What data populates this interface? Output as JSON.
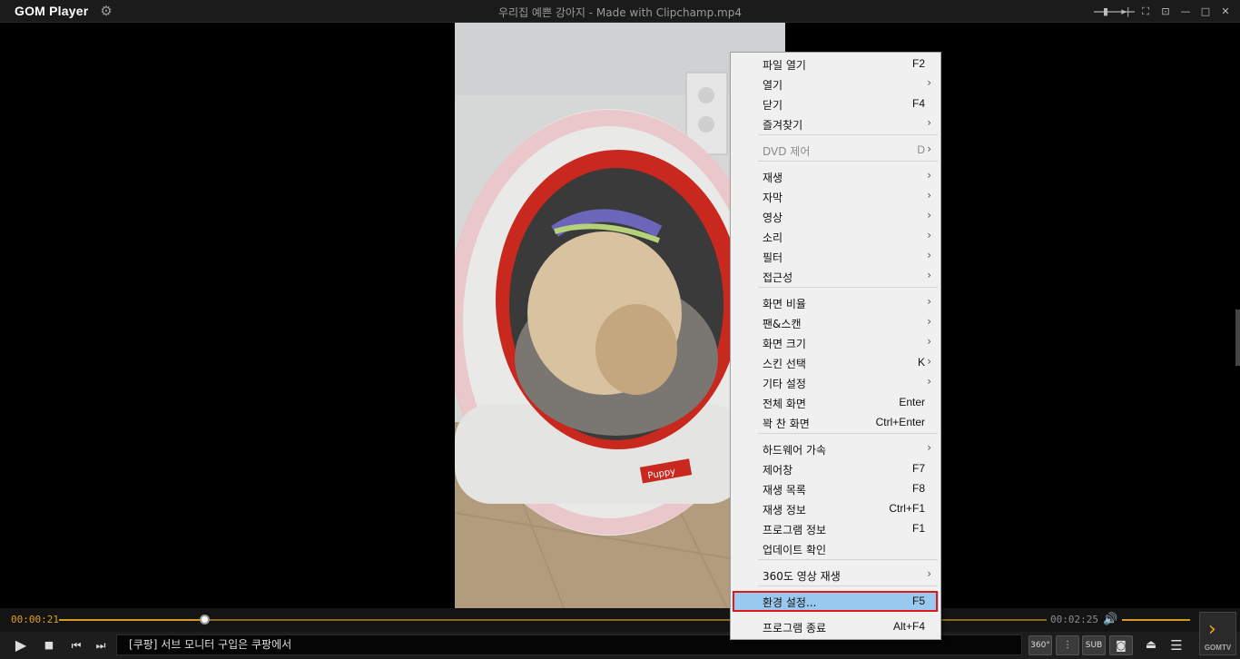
{
  "app": {
    "logo": "GOM Player",
    "window_title": "우리집 예쁜 강아지 - Made with Clipchamp.mp4"
  },
  "player": {
    "time_current": "00:00:21",
    "time_total": "00:02:25",
    "progress_fraction": 0.15,
    "volume_fraction": 1.0,
    "ticker_text": "[쿠팡] 서브 모니터 구입은 쿠팡에서",
    "buttons": {
      "sub": "SUB",
      "360": "360°",
      "gomtv": "GOMTV"
    }
  },
  "context_menu": {
    "highlighted": "환경 설정...",
    "items": [
      {
        "label": "파일 열기",
        "shortcut": "F2",
        "submenu": false
      },
      {
        "label": "열기",
        "shortcut": "",
        "submenu": true
      },
      {
        "label": "닫기",
        "shortcut": "F4",
        "submenu": false
      },
      {
        "label": "즐겨찾기",
        "shortcut": "",
        "submenu": true
      },
      {
        "label": "DVD 제어",
        "shortcut": "D",
        "submenu": true,
        "disabled": true
      },
      {
        "label": "재생",
        "shortcut": "",
        "submenu": true
      },
      {
        "label": "자막",
        "shortcut": "",
        "submenu": true
      },
      {
        "label": "영상",
        "shortcut": "",
        "submenu": true
      },
      {
        "label": "소리",
        "shortcut": "",
        "submenu": true
      },
      {
        "label": "필터",
        "shortcut": "",
        "submenu": true
      },
      {
        "label": "접근성",
        "shortcut": "",
        "submenu": true
      },
      {
        "label": "화면 비율",
        "shortcut": "",
        "submenu": true
      },
      {
        "label": "팬&스캔",
        "shortcut": "",
        "submenu": true
      },
      {
        "label": "화면 크기",
        "shortcut": "",
        "submenu": true
      },
      {
        "label": "스킨 선택",
        "shortcut": "K",
        "submenu": true
      },
      {
        "label": "기타 설정",
        "shortcut": "",
        "submenu": true
      },
      {
        "label": "전체 화면",
        "shortcut": "Enter",
        "submenu": false
      },
      {
        "label": "꽉 찬 화면",
        "shortcut": "Ctrl+Enter",
        "submenu": false
      },
      {
        "label": "하드웨어 가속",
        "shortcut": "",
        "submenu": true
      },
      {
        "label": "제어창",
        "shortcut": "F7",
        "submenu": false
      },
      {
        "label": "재생 목록",
        "shortcut": "F8",
        "submenu": false
      },
      {
        "label": "재생 정보",
        "shortcut": "Ctrl+F1",
        "submenu": false
      },
      {
        "label": "프로그램 정보",
        "shortcut": "F1",
        "submenu": false
      },
      {
        "label": "업데이트 확인",
        "shortcut": "",
        "submenu": false
      },
      {
        "label": "360도 영상 재생",
        "shortcut": "",
        "submenu": true
      },
      {
        "label": "환경 설정...",
        "shortcut": "F5",
        "submenu": false
      },
      {
        "label": "프로그램 종료",
        "shortcut": "Alt+F4",
        "submenu": false
      }
    ]
  },
  "colors": {
    "accent": "#d79a1e",
    "menu_highlight": "#99c9ef",
    "annotation_box": "#e01818"
  }
}
